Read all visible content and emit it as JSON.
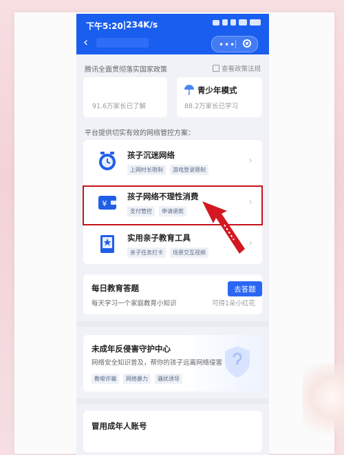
{
  "status_bar": {
    "time": "下午5:20",
    "separator": " | ",
    "speed": "234K/s"
  },
  "nav": {
    "back_icon": "chevron-left-icon"
  },
  "policy": {
    "text": "腾讯全面贯彻落实国家政策",
    "link": "查看政策法规"
  },
  "stats": [
    {
      "title": "",
      "sub": "91.6万家长已了解"
    },
    {
      "title": "青少年模式",
      "sub": "88.2万家长已学习"
    }
  ],
  "solutions_label": "平台提供切实有效的网络管控方案：",
  "items": [
    {
      "title": "孩子沉迷网络",
      "tags": [
        "上网时长限制",
        "游戏登录限制"
      ],
      "icon": "alarm-clock-icon"
    },
    {
      "title": "孩子网络不理性消费",
      "tags": [
        "支付管控",
        "申请退款"
      ],
      "icon": "wallet-yen-icon"
    },
    {
      "title": "实用亲子教育工具",
      "tags": [
        "亲子任务打卡",
        "场景交互视频"
      ],
      "icon": "notebook-star-icon"
    }
  ],
  "quiz": {
    "title": "每日教育答题",
    "sub": "每天学习一个家庭教育小知识",
    "button": "去答题",
    "reward": "可得1朵小红花"
  },
  "protect": {
    "title": "未成年反侵害守护中心",
    "sub": "网络安全知识普及，帮你的孩子远离网络侵害",
    "tags": [
      "教唆诈骗",
      "网络暴力",
      "骚扰诱导"
    ]
  },
  "account": {
    "title": "冒用成年人账号"
  },
  "colors": {
    "brand": "#1a5ef0",
    "highlight": "#c4111b"
  }
}
